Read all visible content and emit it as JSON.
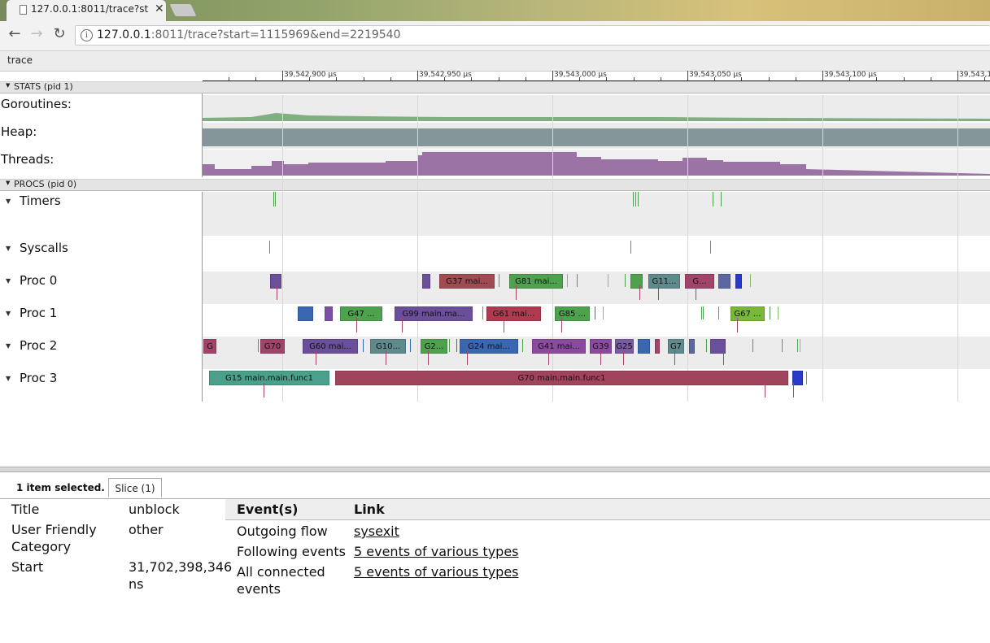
{
  "browser": {
    "tab_title": "127.0.0.1:8011/trace?st",
    "url_host": "127.0.0.1",
    "url_rest": ":8011/trace?start=1115969&end=2219540"
  },
  "trace_tab": "trace",
  "ruler": {
    "labels": [
      "39,542,900 µs",
      "39,542,950 µs",
      "39,543,000 µs",
      "39,543,050 µs",
      "39,543,100 µs",
      "39,543,1"
    ]
  },
  "sections": {
    "stats": "STATS (pid 1)",
    "procs": "PROCS (pid 0)"
  },
  "rows": {
    "goroutines": "Goroutines:",
    "heap": "Heap:",
    "threads": "Threads:",
    "timers": "Timers",
    "syscalls": "Syscalls",
    "proc0": "Proc 0",
    "proc1": "Proc 1",
    "proc2": "Proc 2",
    "proc3": "Proc 3"
  },
  "colors": {
    "goroutines": "#6fa56f",
    "heap": "#84969a",
    "threads": "#9b74a5",
    "flow": "#a0446a"
  },
  "slices": {
    "proc0": [
      "G37 mai...",
      "G81 mai...",
      "G11...",
      "G..."
    ],
    "proc1": [
      "G47 ...",
      "G99 main.ma...",
      "G61 mai...",
      "G85 ...",
      "G67 ..."
    ],
    "proc2": [
      "G",
      "G70",
      "G60 mai...",
      "G10...",
      "G2...",
      "G24 mai...",
      "G41 mai...",
      "G39",
      "G25",
      "G7"
    ],
    "proc3": [
      "G15 main.main.func1",
      "G70 main.main.func1"
    ]
  },
  "panel": {
    "selection": "1 item selected.",
    "tab": "Slice (1)",
    "props": [
      {
        "key": "Title",
        "value": "unblock"
      },
      {
        "key": "User Friendly Category",
        "value": "other"
      },
      {
        "key": "Start",
        "value": "31,702,398,346 ns"
      }
    ],
    "events_header": "Event(s)",
    "link_header": "Link",
    "events": [
      {
        "event": "Outgoing flow",
        "link": "sysexit"
      },
      {
        "event": "Following events",
        "link": "5 events of various types"
      },
      {
        "event": "All connected events",
        "link": "5 events of various types"
      }
    ]
  }
}
